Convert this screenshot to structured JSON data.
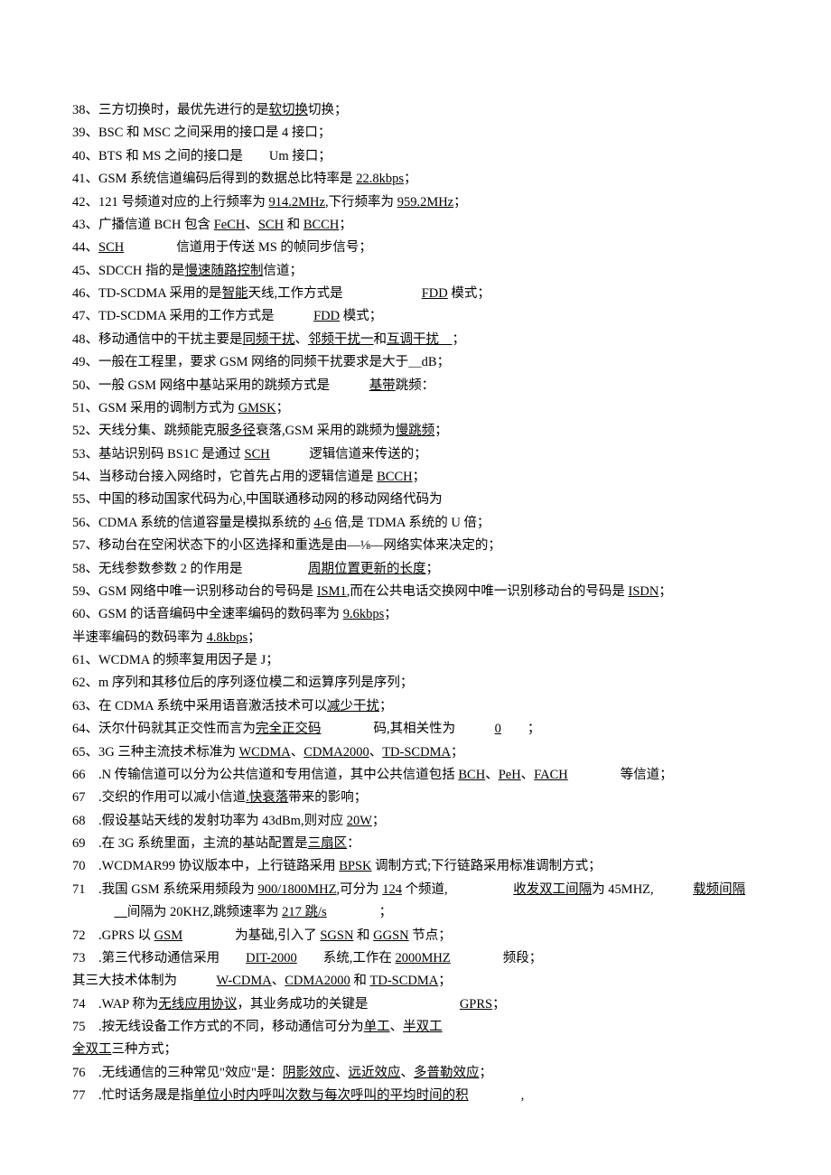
{
  "lines": [
    {
      "n": "38、",
      "segs": [
        "三方切换时，最优先进行的是",
        {
          "u": "软切换"
        },
        "切换；"
      ]
    },
    {
      "n": "39、",
      "segs": [
        "BSC 和 MSC 之间采用的接口是 4 接口；"
      ]
    },
    {
      "n": "40、",
      "segs": [
        "BTS 和 MS 之间的接口是　　Um 接口；"
      ]
    },
    {
      "n": "41、",
      "segs": [
        "GSM 系统信道编码后得到的数据总比特率是 ",
        {
          "u": "22.8kbps"
        },
        "；"
      ]
    },
    {
      "n": "42、",
      "segs": [
        "121 号频道对应的上行频率为 ",
        {
          "u": "914.2MHz"
        },
        ",下行频率为 ",
        {
          "u": "959.2MHz"
        },
        "；"
      ]
    },
    {
      "n": "43、",
      "segs": [
        "广播信道 BCH 包含 ",
        {
          "u": "FeCH"
        },
        "、",
        {
          "u": "SCH"
        },
        " 和 ",
        {
          "u": "BCCH"
        },
        "；"
      ]
    },
    {
      "n": "44、",
      "segs": [
        {
          "u": "SCH"
        },
        "　　　　信道用于传送 MS 的帧同步信号；"
      ]
    },
    {
      "n": "45、",
      "segs": [
        "SDCCH 指的是",
        {
          "u": "慢速随路控制"
        },
        "信道；"
      ]
    },
    {
      "n": "46、",
      "segs": [
        "TD-SCDMA 采用的是",
        {
          "u": "智能"
        },
        "天线,工作方式是　　　　　　",
        {
          "u": "FDD"
        },
        " 模式；"
      ]
    },
    {
      "n": "47、",
      "segs": [
        "TD-SCDMA 采用的工作方式是　　　",
        {
          "u": "FDD"
        },
        " 模式；"
      ]
    },
    {
      "n": "48、",
      "segs": [
        "移动通信中的干扰主要是",
        {
          "u": "同频干扰"
        },
        "、",
        {
          "u": "邻频干扰一"
        },
        "和",
        {
          "u": "互调干扰　"
        },
        "；"
      ]
    },
    {
      "n": "49、",
      "segs": [
        "一般在工程里，要求 GSM 网络的同频干扰要求是大于＿dB；"
      ]
    },
    {
      "n": "50、",
      "segs": [
        "一般 GSM 网络中基站采用的跳频方式是　　　",
        {
          "u": "基带"
        },
        "跳频："
      ]
    },
    {
      "n": "51、",
      "segs": [
        "GSM 采用的调制方式为 ",
        {
          "u": "GMSK"
        },
        "；"
      ]
    },
    {
      "n": "52、",
      "segs": [
        "天线分集、跳频能克服",
        {
          "u": "多径"
        },
        "衰落,GSM 采用的跳频为",
        {
          "u": "慢跳频"
        },
        "；"
      ]
    },
    {
      "n": "53、",
      "segs": [
        "基站识别码 BS1C 是通过 ",
        {
          "u": "SCH"
        },
        "　　　逻辑信道来传送的；"
      ]
    },
    {
      "n": "54、",
      "segs": [
        "当移动台接入网络时，它首先占用的逻辑信道是 ",
        {
          "u": "BCCH"
        },
        "；"
      ]
    },
    {
      "n": "55、",
      "segs": [
        "中国的移动国家代码为心,中国联通移动网的移动网络代码为"
      ]
    },
    {
      "n": "56、",
      "segs": [
        "CDMA 系统的信道容量是模拟系统的 ",
        {
          "u": "4-6"
        },
        " 倍,是 TDMA 系统的 U 倍；"
      ]
    },
    {
      "n": "57、",
      "segs": [
        "移动台在空闲状态下的小区选择和重选是由—⅛—网络实体来决定的；"
      ]
    },
    {
      "n": "58、",
      "segs": [
        "无线参数参数 2 的作用是　　　　　",
        {
          "u": "周期位置更新的长度"
        },
        "；"
      ]
    },
    {
      "n": "59、",
      "segs": [
        "GSM 网络中唯一识别移动台的号码是 ",
        {
          "u": "ISM1"
        },
        ",而在公共电话交换网中唯一识别移动台的号码是 ",
        {
          "u": "ISDN"
        },
        "；"
      ]
    },
    {
      "n": "60、",
      "segs": [
        "GSM 的话音编码中全速率编码的数码率为 ",
        {
          "u": "9.6kbps"
        },
        "；"
      ]
    },
    {
      "sub": true,
      "segs": [
        "半速率编码的数码率为 ",
        {
          "u": "4.8kbps"
        },
        "；"
      ]
    },
    {
      "n": "61、",
      "segs": [
        "WCDMA 的频率复用因子是 J；"
      ]
    },
    {
      "n": "62、",
      "segs": [
        "m 序列和其移位后的序列逐位模二和运算序列是序列；"
      ]
    },
    {
      "n": "63、",
      "segs": [
        "在 CDMA 系统中采用语音激活技术可以",
        {
          "u": "减少干扰"
        },
        "；"
      ]
    },
    {
      "n": "64、",
      "segs": [
        "沃尔什码就其正交性而言为",
        {
          "u": "完全正交码"
        },
        "　　　　码,其相关性为　　　",
        {
          "u": "0"
        },
        "　　；"
      ]
    },
    {
      "n": "65、",
      "segs": [
        "3G 三种主流技术标准为 ",
        {
          "u": "WCDMA"
        },
        "、",
        {
          "u": "CDMA2000"
        },
        "、",
        {
          "u": "TD-SCDMA"
        },
        "；"
      ]
    },
    {
      "n": "66　.",
      "segs": [
        "N 传输信道可以分为公共信道和专用信道，其中公共信道包括 ",
        {
          "u": "BCH"
        },
        "、",
        {
          "u": "PeH"
        },
        "、",
        {
          "u": "FACH"
        },
        "　　　　等信道；"
      ]
    },
    {
      "n": "67　.",
      "segs": [
        "交织的作用可以减小信道",
        {
          "u": ".快衰落"
        },
        "带来的影响；"
      ]
    },
    {
      "n": "68　.",
      "segs": [
        "假设基站天线的发射功率为 43dBm,则对应 ",
        {
          "u": "20W"
        },
        "；"
      ]
    },
    {
      "n": "69　.",
      "segs": [
        "在 3G 系统里面，主流的基站配置是",
        {
          "u": "三扇区"
        },
        "："
      ]
    },
    {
      "n": "70　.",
      "segs": [
        "WCDMAR99 协议版本中，上行链路采用 ",
        {
          "u": "BPSK"
        },
        " 调制方式;下行链路采用标准调制方式；"
      ]
    },
    {
      "n": "71　.",
      "segs": [
        "我国 GSM 系统采用频段为 ",
        {
          "u": "900/1800MHZ"
        },
        ",可分为 ",
        {
          "u": "124"
        },
        " 个频道,　　　　　",
        {
          "u": "收发双工间隔"
        },
        "为 45MHZ,　　　",
        {
          "u": "载频间隔"
        }
      ]
    },
    {
      "indent": true,
      "segs": [
        {
          "u": "　"
        },
        "间隔为 20KHZ,跳频速率为 ",
        {
          "u": "217 跳/s"
        },
        "　　　　；"
      ]
    },
    {
      "n": "72　.",
      "segs": [
        "GPRS 以 ",
        {
          "u": "GSM"
        },
        "　　　　为基础,引入了 ",
        {
          "u": "SGSN"
        },
        " 和 ",
        {
          "u": "GGSN"
        },
        " 节点；"
      ]
    },
    {
      "n": "73　.",
      "segs": [
        "第三代移动通信采用　　",
        {
          "u": "DIT-2000"
        },
        "　　系统,工作在 ",
        {
          "u": "2000MHZ"
        },
        "　　　　频段；"
      ]
    },
    {
      "sub": true,
      "segs": [
        "其三大技术体制为　　　",
        {
          "u": "W-CDMA"
        },
        "、",
        {
          "u": "CDMA2000"
        },
        " 和 ",
        {
          "u": "TD-SCDMA"
        },
        "；"
      ]
    },
    {
      "n": "74　.",
      "segs": [
        "WAP 称为",
        {
          "u": "无线应用协议"
        },
        "，其业务成功的关键是　　　　　　　",
        {
          "u": "GPRS"
        },
        "；"
      ]
    },
    {
      "n": "75　.",
      "segs": [
        "按无线设备工作方式的不同，移动通信可分为",
        {
          "u": "单工"
        },
        "、",
        {
          "u": "半双工"
        }
      ]
    },
    {
      "sub": true,
      "segs": [
        {
          "u": "全双工"
        },
        "三种方式；"
      ]
    },
    {
      "n": "76　.",
      "segs": [
        "无线通信的三种常见\"效应\"是：",
        {
          "u": "阴影效应"
        },
        "、",
        {
          "u": "远近效应"
        },
        "、",
        {
          "u": "多普勒效应"
        },
        "；"
      ]
    },
    {
      "n": "77　.",
      "segs": [
        "忙时话务晟是指",
        {
          "u": "单位小时内呼叫次数与每次呼叫的平均时间的积"
        },
        "　　　　,"
      ]
    }
  ]
}
